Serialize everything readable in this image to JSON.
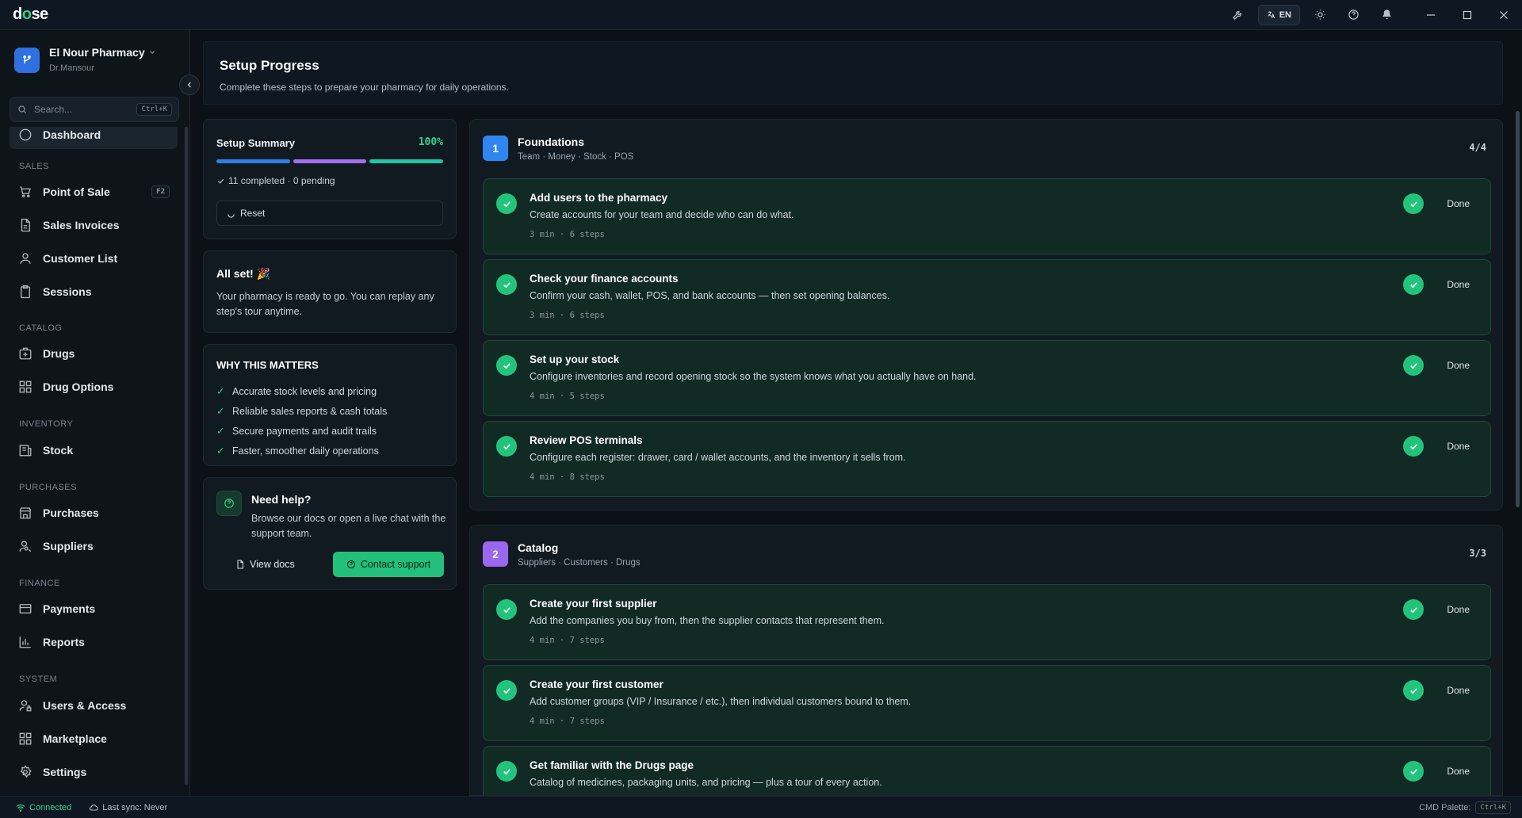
{
  "app": {
    "logo": "dose"
  },
  "titlebar": {
    "lang_label": "EN"
  },
  "sidebar": {
    "org_name": "El Nour Pharmacy",
    "org_user": "Dr.Mansour",
    "search_placeholder": "Search...",
    "search_shortcut": "Ctrl+K",
    "partial_item": "Dashboard",
    "sections": {
      "sales": "SALES",
      "catalog": "CATALOG",
      "inventory": "INVENTORY",
      "purchases": "PURCHASES",
      "finance": "FINANCE",
      "system": "SYSTEM"
    },
    "items": {
      "pos": "Point of Sale",
      "pos_badge": "F2",
      "sales_invoices": "Sales Invoices",
      "customer_list": "Customer List",
      "sessions": "Sessions",
      "drugs": "Drugs",
      "drug_options": "Drug Options",
      "stock": "Stock",
      "purchases": "Purchases",
      "suppliers": "Suppliers",
      "payments": "Payments",
      "reports": "Reports",
      "users_access": "Users & Access",
      "marketplace": "Marketplace",
      "settings": "Settings"
    }
  },
  "header": {
    "title": "Setup Progress",
    "subtitle": "Complete these steps to prepare your pharmacy for daily operations."
  },
  "summary": {
    "title": "Setup Summary",
    "percent": "100%",
    "status": "11 completed · 0 pending",
    "reset_label": "Reset",
    "progress": 1.0,
    "bar_colors": [
      "#2f7fe6",
      "#a46ef0",
      "#1fc5a4"
    ]
  },
  "allset": {
    "title": "All set! 🎉",
    "text": "Your pharmacy is ready to go. You can replay any step's tour anytime."
  },
  "why": {
    "title": "WHY THIS MATTERS",
    "items": [
      "Accurate stock levels and pricing",
      "Reliable sales reports & cash totals",
      "Secure payments and audit trails",
      "Faster, smoother daily operations"
    ]
  },
  "help": {
    "title": "Need help?",
    "text": "Browse our docs or open a live chat with the support team.",
    "docs_label": "View docs",
    "support_label": "Contact support"
  },
  "groups": [
    {
      "number": "1",
      "title": "Foundations",
      "subtitle": "Team · Money · Stock · POS",
      "count": "4/4",
      "color": "#2f86f0",
      "steps": [
        {
          "title": "Add users to the pharmacy",
          "desc": "Create accounts for your team and decide who can do what.",
          "meta": "3 min · 6 steps",
          "status": "Done"
        },
        {
          "title": "Check your finance accounts",
          "desc": "Confirm your cash, wallet, POS, and bank accounts — then set opening balances.",
          "meta": "3 min · 6 steps",
          "status": "Done"
        },
        {
          "title": "Set up your stock",
          "desc": "Configure inventories and record opening stock so the system knows what you actually have on hand.",
          "meta": "4 min · 5 steps",
          "status": "Done"
        },
        {
          "title": "Review POS terminals",
          "desc": "Configure each register: drawer, card / wallet accounts, and the inventory it sells from.",
          "meta": "4 min · 8 steps",
          "status": "Done"
        }
      ]
    },
    {
      "number": "2",
      "title": "Catalog",
      "subtitle": "Suppliers · Customers · Drugs",
      "count": "3/3",
      "color": "#9b67ee",
      "steps": [
        {
          "title": "Create your first supplier",
          "desc": "Add the companies you buy from, then the supplier contacts that represent them.",
          "meta": "4 min · 7 steps",
          "status": "Done"
        },
        {
          "title": "Create your first customer",
          "desc": "Add customer groups (VIP / Insurance / etc.), then individual customers bound to them.",
          "meta": "4 min · 7 steps",
          "status": "Done"
        },
        {
          "title": "Get familiar with the Drugs page",
          "desc": "Catalog of medicines, packaging units, and pricing — plus a tour of every action.",
          "meta": "",
          "status": "Done"
        }
      ]
    }
  ],
  "statusbar": {
    "connected": "Connected",
    "last_sync": "Last sync: Never",
    "cmd_label": "CMD Palette:",
    "cmd_key": "Ctrl+K"
  }
}
